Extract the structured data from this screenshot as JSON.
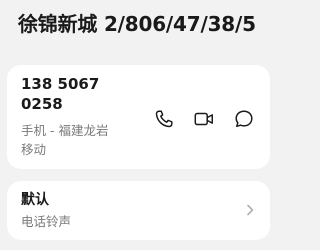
{
  "contact": {
    "name": "徐锦新城 2/806/47/38/5"
  },
  "phone": {
    "number": "138 5067 0258",
    "label": "手机 - 福建龙岩",
    "carrier": "移动",
    "actions": [
      {
        "icon": "phone-icon"
      },
      {
        "icon": "video-icon"
      },
      {
        "icon": "message-icon"
      }
    ]
  },
  "ringtone": {
    "value": "默认",
    "label": "电话铃声",
    "icon": "chevron-right-icon"
  },
  "colors": {
    "background": "#f2f2f2",
    "card": "#ffffff",
    "primary_text": "#1a1a1a",
    "secondary_text": "#7a7a7a"
  }
}
